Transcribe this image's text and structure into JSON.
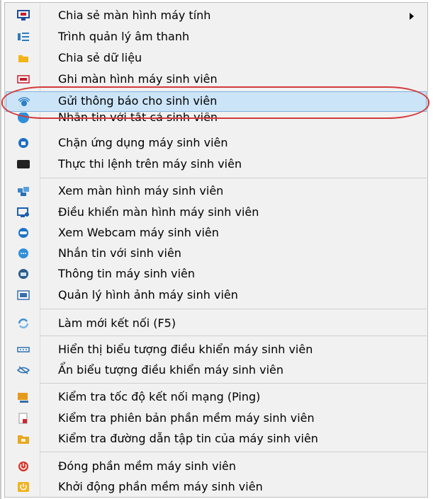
{
  "menu": {
    "items": [
      {
        "label": "Chia sẻ màn hình máy tính",
        "icon": "monitor-share-icon",
        "color": "#1e4e9c",
        "submenu": true
      },
      {
        "label": "Trình quản lý âm thanh",
        "icon": "audio-manager-icon",
        "color": "#2b7bbf"
      },
      {
        "label": "Chia sẻ dữ liệu",
        "icon": "folder-icon",
        "color": "#f2b417"
      },
      {
        "label": "Ghi màn hình máy sinh viên",
        "icon": "record-screen-icon",
        "color": "#c21e2b"
      },
      {
        "label": "Gửi thông báo cho sinh viên",
        "icon": "broadcast-icon",
        "color": "#2a7ec8",
        "highlighted": true
      },
      {
        "label": "Nhắn tin với tất cả sinh viên",
        "icon": "chat-all-icon",
        "color": "#2f8fd8"
      },
      {
        "label": "Chặn ứng dụng máy sinh viên",
        "icon": "block-app-icon",
        "color": "#1f6fbf"
      },
      {
        "label": "Thực thi lệnh trên máy sinh viên",
        "icon": "terminal-icon",
        "color": "#222222"
      },
      {
        "label": "Xem màn hình máy sinh viên",
        "icon": "view-screen-icon",
        "color": "#3a86c9"
      },
      {
        "label": "Điều khiển màn hình máy sinh viên",
        "icon": "remote-control-icon",
        "color": "#1e5fae"
      },
      {
        "label": "Xem Webcam máy sinh viên",
        "icon": "webcam-icon",
        "color": "#1f73c6"
      },
      {
        "label": "Nhắn tin với sinh viên",
        "icon": "chat-icon",
        "color": "#2f8fd8"
      },
      {
        "label": "Thông tin máy sinh viên",
        "icon": "info-icon",
        "color": "#2a5d8a"
      },
      {
        "label": "Quản lý hình ảnh máy sinh viên",
        "icon": "image-manager-icon",
        "color": "#356fae"
      },
      {
        "label": "Làm mới kết nối (F5)",
        "icon": "refresh-icon",
        "color": "#3a8fd0"
      },
      {
        "label": "Hiển thị biểu tượng điều khiển máy sinh viên",
        "icon": "show-controls-icon",
        "color": "#2a6fb3"
      },
      {
        "label": "Ẩn biểu tượng điều khiển máy sinh viên",
        "icon": "hide-controls-icon",
        "color": "#2a6fb3"
      },
      {
        "label": "Kiểm tra tốc độ kết nối mạng (Ping)",
        "icon": "ping-icon",
        "color": "#e59a1c"
      },
      {
        "label": "Kiểm tra phiên bản phần mềm máy sinh viên",
        "icon": "version-icon",
        "color": "#c8292f"
      },
      {
        "label": "Kiểm tra đường dẫn tập tin của máy sinh viên",
        "icon": "file-path-icon",
        "color": "#e8a823"
      },
      {
        "label": "Đóng phần mềm máy sinh viên",
        "icon": "power-off-icon",
        "color": "#d9352b"
      },
      {
        "label": "Khởi động phần mềm máy sinh viên",
        "icon": "start-app-icon",
        "color": "#f0b420"
      }
    ]
  },
  "annotation": {
    "color": "#d33b3b"
  }
}
